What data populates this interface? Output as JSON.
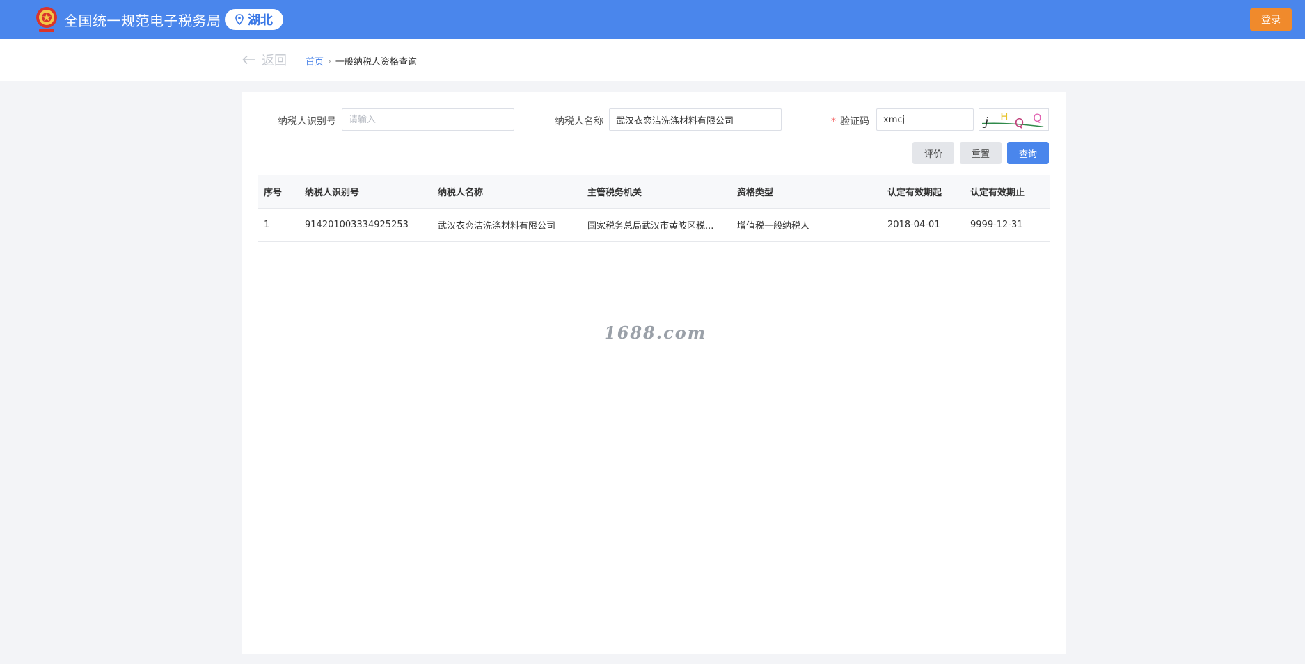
{
  "header": {
    "site_title": "全国统一规范电子税务局",
    "region": "湖北",
    "login_label": "登录",
    "emblem_icon": "tax-emblem-icon",
    "location_icon": "map-pin-icon"
  },
  "breadcrumb": {
    "back_label": "返回",
    "home": "首页",
    "separator": "›",
    "current": "一般纳税人资格查询"
  },
  "form": {
    "taxpayer_id_label": "纳税人识别号",
    "taxpayer_id_placeholder": "请输入",
    "taxpayer_id_value": "",
    "taxpayer_name_label": "纳税人名称",
    "taxpayer_name_value": "武汉衣恋洁洗涤材料有限公司",
    "captcha_required": "*",
    "captcha_label": "验证码",
    "captcha_value": "xmcj",
    "captcha_chars": [
      "j",
      "H",
      "Q",
      "Q"
    ]
  },
  "buttons": {
    "evaluate": "评价",
    "reset": "重置",
    "query": "查询"
  },
  "table": {
    "headers": [
      "序号",
      "纳税人识别号",
      "纳税人名称",
      "主管税务机关",
      "资格类型",
      "认定有效期起",
      "认定有效期止"
    ],
    "rows": [
      [
        "1",
        "914201003334925253",
        "武汉衣恋洁洗涤材料有限公司",
        "国家税务总局武汉市黄陂区税...",
        "增值税一般纳税人",
        "2018-04-01",
        "9999-12-31"
      ]
    ]
  },
  "watermark": "1688.com",
  "colors": {
    "header_blue": "#4a86ec",
    "login_orange": "#f08a2c",
    "link_blue": "#3a78e6",
    "required_red": "#f56c6c"
  }
}
